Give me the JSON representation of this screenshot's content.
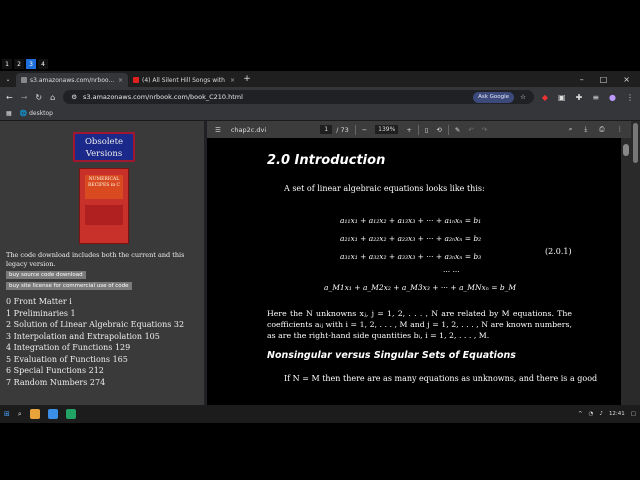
{
  "desktops": [
    "1",
    "2",
    "3",
    "4"
  ],
  "browser": {
    "menu_icon": "chevron-down-icon",
    "tabs": [
      {
        "title": "s3.amazonaws.com/nrbook.com/",
        "close": "×"
      },
      {
        "title": "(4) All Silent Hill Songs with",
        "close": "×"
      }
    ],
    "new_tab": "+",
    "window_controls": [
      "–",
      "□",
      "×"
    ],
    "url": "s3.amazonaws.com/nrbook.com/book_C210.html",
    "ask_google": "Ask Google",
    "bookmark": "desktop"
  },
  "left_panel": {
    "obsolete_line1": "Obsolete",
    "obsolete_line2": "Versions",
    "book_title": "NUMERICAL RECIPES in C",
    "note": "The code download includes both the current and this legacy version.",
    "btn_download": "buy source code download",
    "btn_license": "buy site license for commercial use of code",
    "toc": [
      "0 Front Matter i",
      "1 Preliminaries 1",
      "2 Solution of Linear Algebraic Equations 32",
      "3 Interpolation and Extrapolation 105",
      "4 Integration of Functions 129",
      "5 Evaluation of Functions 165",
      "6 Special Functions 212",
      "7 Random Numbers 274"
    ]
  },
  "pdf": {
    "filename": "chap2c.dvi",
    "page": "1",
    "total": "/ 73",
    "zoom": "139%",
    "heading": "2.0 Introduction",
    "intro": "A set of linear algebraic equations looks like this:",
    "equations": [
      "a₁₁x₁ + a₁₂x₂ + a₁₃x₃ + ··· + a₁ₙxₙ = b₁",
      "a₂₁x₁ + a₂₂x₂ + a₂₃x₃ + ··· + a₂ₙxₙ = b₂",
      "a₃₁x₁ + a₃₂x₂ + a₃₃x₃ + ··· + a₃ₙxₙ = b₃",
      "···                                          ···",
      "a_M1x₁ + a_M2x₂ + a_M3x₃ + ··· + a_MNxₙ = b_M"
    ],
    "eq_number": "(2.0.1)",
    "para": "Here the N unknowns xⱼ, j = 1, 2, . . . , N are related by M equations. The coefficients aᵢⱼ with i = 1, 2, . . . , M and j = 1, 2, . . . , N are known numbers, as are the right-hand side quantities bᵢ, i = 1, 2, . . . , M.",
    "subheading": "Nonsingular versus Singular Sets of Equations",
    "para2": "If N = M then there are as many equations as unknowns, and there is a good"
  },
  "taskbar": {
    "time": "12:41"
  }
}
